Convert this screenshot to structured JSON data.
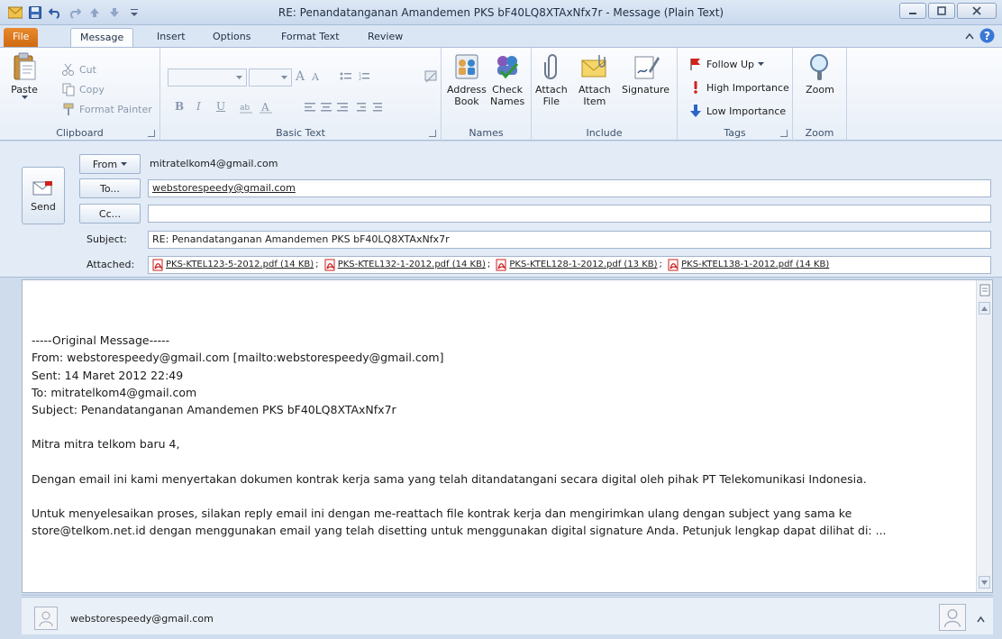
{
  "window": {
    "title": "RE: Penandatanganan Amandemen PKS bF40LQ8XTAxNfx7r  -  Message (Plain Text)"
  },
  "tabs": [
    "File",
    "Message",
    "Insert",
    "Options",
    "Format Text",
    "Review"
  ],
  "ribbon": {
    "clipboard": {
      "paste": "Paste",
      "cut": "Cut",
      "copy": "Copy",
      "format_painter": "Format Painter",
      "label": "Clipboard"
    },
    "basic_text": {
      "label": "Basic Text",
      "bold": "B",
      "italic": "I",
      "underline": "U",
      "font_grow": "A",
      "font_shrink": "A"
    },
    "names": {
      "address_book_1": "Address",
      "address_book_2": "Book",
      "check_names_1": "Check",
      "check_names_2": "Names",
      "label": "Names"
    },
    "include": {
      "attach_file_1": "Attach",
      "attach_file_2": "File",
      "attach_item_1": "Attach",
      "attach_item_2": "Item",
      "signature": "Signature",
      "label": "Include"
    },
    "tags": {
      "follow_up": "Follow Up",
      "high_importance": "High Importance",
      "low_importance": "Low Importance",
      "label": "Tags"
    },
    "zoom": {
      "zoom": "Zoom",
      "label": "Zoom"
    }
  },
  "compose": {
    "send": "Send",
    "from_button": "From",
    "from_value": "mitratelkom4@gmail.com",
    "to_button": "To...",
    "to_value": "webstorespeedy@gmail.com",
    "cc_button": "Cc...",
    "cc_value": "",
    "subject_label": "Subject:",
    "subject_value": "RE: Penandatanganan Amandemen PKS bF40LQ8XTAxNfx7r",
    "attached_label": "Attached:",
    "attachments": [
      "PKS-KTEL123-5-2012.pdf (14 KB)",
      "PKS-KTEL132-1-2012.pdf (14 KB)",
      "PKS-KTEL128-1-2012.pdf (13 KB)",
      "PKS-KTEL138-1-2012.pdf (14 KB)"
    ],
    "attach_separator": ";"
  },
  "body": {
    "lines": [
      "-----Original Message-----",
      "From: webstorespeedy@gmail.com [mailto:webstorespeedy@gmail.com]",
      "Sent: 14 Maret 2012 22:49",
      "To: mitratelkom4@gmail.com",
      "Subject: Penandatanganan Amandemen PKS bF40LQ8XTAxNfx7r",
      "",
      "Mitra mitra telkom baru 4,",
      "",
      "Dengan email ini kami menyertakan dokumen kontrak kerja sama yang telah ditandatangani secara digital oleh pihak PT Telekomunikasi Indonesia.",
      "",
      "Untuk menyelesaikan proses, silakan reply email ini dengan me-reattach file kontrak kerja dan mengirimkan ulang dengan subject yang sama ke",
      "store@telkom.net.id dengan menggunakan email yang telah disetting untuk menggunakan digital signature Anda. Petunjuk lengkap dapat dilihat di: ..."
    ]
  },
  "people_pane": {
    "name": "webstorespeedy@gmail.com"
  },
  "colors": {
    "file_tab": "#d9751c",
    "ribbon_bg": "#fbfcfe",
    "frame": "#cfdcec",
    "high_importance": "#d0211b",
    "low_importance": "#2a64c5",
    "pdf": "#cc1f1f"
  }
}
